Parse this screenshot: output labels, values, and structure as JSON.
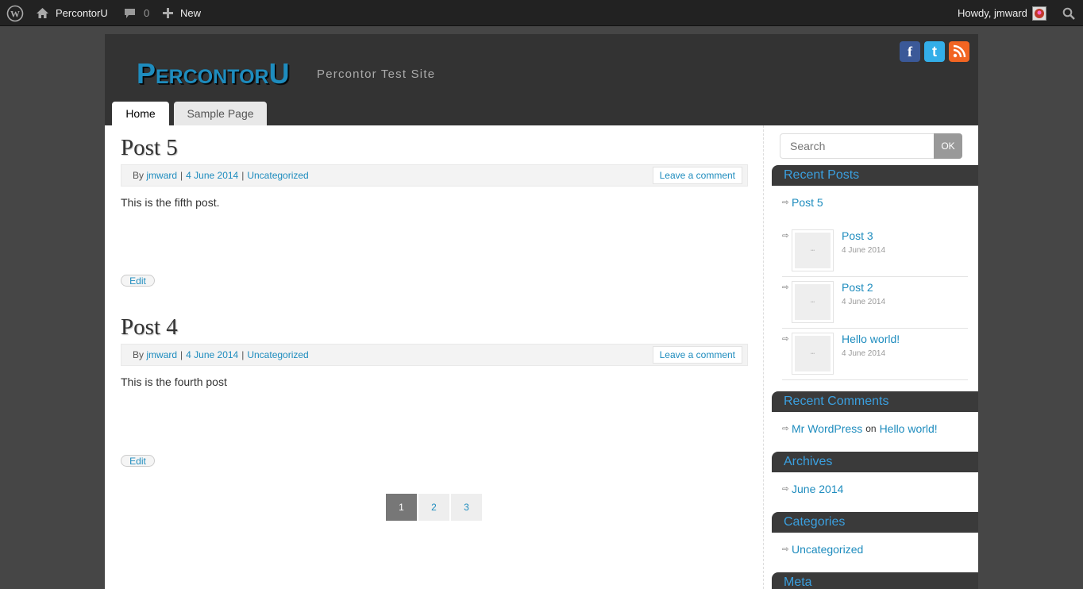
{
  "adminbar": {
    "site_name": "PercontorU",
    "comments_count": "0",
    "new_label": "New",
    "howdy": "Howdy, jmward"
  },
  "header": {
    "site_title": "PercontorU",
    "tagline": "Percontor Test Site",
    "social": [
      {
        "name": "facebook",
        "glyph": "f",
        "color": "#3b5998"
      },
      {
        "name": "twitter",
        "glyph": "t",
        "color": "#33aee8"
      },
      {
        "name": "rss",
        "glyph": "rss",
        "color": "#f26522"
      }
    ],
    "tabs": [
      {
        "label": "Home",
        "active": true
      },
      {
        "label": "Sample Page",
        "active": false
      }
    ]
  },
  "posts": [
    {
      "title": "Post 5",
      "by": "By",
      "author": "jmward",
      "date": "4 June 2014",
      "category": "Uncategorized",
      "comment_link": "Leave a comment",
      "content": "This is the fifth post.",
      "edit": "Edit"
    },
    {
      "title": "Post 4",
      "by": "By",
      "author": "jmward",
      "date": "4 June 2014",
      "category": "Uncategorized",
      "comment_link": "Leave a comment",
      "content": "This is the fourth post",
      "edit": "Edit"
    }
  ],
  "pagination": {
    "pages": [
      "1",
      "2",
      "3"
    ],
    "current": "1"
  },
  "sidebar": {
    "search_placeholder": "Search",
    "search_button": "OK",
    "recent_posts": {
      "title": "Recent Posts",
      "first": "Post 5",
      "items": [
        {
          "title": "Post 3",
          "date": "4 June 2014"
        },
        {
          "title": "Post 2",
          "date": "4 June 2014"
        },
        {
          "title": "Hello world!",
          "date": "4 June 2014"
        }
      ]
    },
    "recent_comments": {
      "title": "Recent Comments",
      "author": "Mr WordPress",
      "on": "on",
      "post": "Hello world!"
    },
    "archives": {
      "title": "Archives",
      "items": [
        "June 2014"
      ]
    },
    "categories": {
      "title": "Categories",
      "items": [
        "Uncategorized"
      ]
    },
    "meta": {
      "title": "Meta"
    }
  },
  "colors": {
    "accent": "#1e8cbe",
    "admin_bar": "#222222",
    "header_bg": "#333333"
  }
}
